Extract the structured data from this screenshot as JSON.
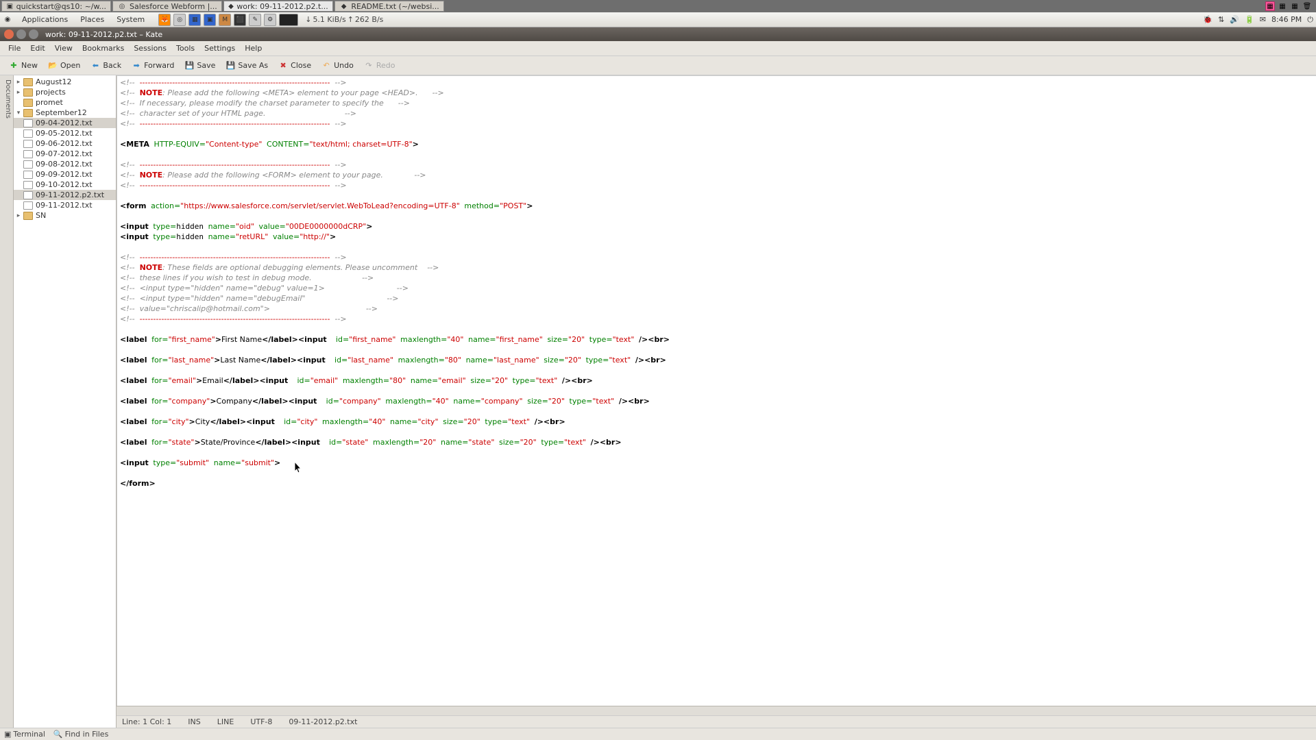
{
  "taskbar": {
    "tabs": [
      {
        "label": "quickstart@qs10: ~/w..."
      },
      {
        "label": "Salesforce Webform |..."
      },
      {
        "label": "work: 09-11-2012.p2.t..."
      },
      {
        "label": "README.txt (~/websi..."
      }
    ]
  },
  "gnome": {
    "menus": [
      "Applications",
      "Places",
      "System"
    ],
    "net_down": "5.1 KiB/s",
    "net_up": "262 B/s",
    "time": "8:46 PM"
  },
  "window": {
    "title": "work: 09-11-2012.p2.txt – Kate"
  },
  "menubar": [
    "File",
    "Edit",
    "View",
    "Bookmarks",
    "Sessions",
    "Tools",
    "Settings",
    "Help"
  ],
  "toolbar": {
    "new": "New",
    "open": "Open",
    "back": "Back",
    "forward": "Forward",
    "save": "Save",
    "saveas": "Save As",
    "close": "Close",
    "undo": "Undo",
    "redo": "Redo"
  },
  "sidebar": {
    "tab": "Documents",
    "folders": {
      "aug": "August12",
      "projects": "projects",
      "promet": "promet",
      "sept": "September12",
      "sn": "SN"
    },
    "files": [
      "09-04-2012.txt",
      "09-05-2012.txt",
      "09-06-2012.txt",
      "09-07-2012.txt",
      "09-08-2012.txt",
      "09-09-2012.txt",
      "09-10-2012.txt",
      "09-11-2012.p2.txt",
      "09-11-2012.txt"
    ],
    "selected": "09-11-2012.p2.txt"
  },
  "code": {
    "note": "NOTE",
    "c1a": "Please add the following <META> element to your page <HEAD>.",
    "c1b": "If necessary, please modify the charset parameter to specify the",
    "c1c": "character set of your HTML page.",
    "meta_httpequiv": "HTTP-EQUIV=",
    "meta_httpequiv_v": "\"Content-type\"",
    "meta_content": "CONTENT=",
    "meta_content_v": "\"text/html; charset=UTF-8\"",
    "c2": "Please add the following <FORM> element to your page.",
    "form_action": "action=",
    "form_action_v": "\"https://www.salesforce.com/servlet/servlet.WebToLead?encoding=UTF-8\"",
    "form_method": "method=",
    "form_method_v": "\"POST\"",
    "hid1_name": "\"oid\"",
    "hid1_val": "\"00DE0000000dCRP\"",
    "hid2_name": "\"retURL\"",
    "hid2_val": "\"http://\"",
    "c3a": "These fields are optional debugging elements. Please uncomment",
    "c3b": "these lines if you wish to test in debug mode.",
    "c3c": "<input type=\"hidden\" name=\"debug\" value=1>",
    "c3d": "<input type=\"hidden\" name=\"debugEmail\"",
    "c3e": "value=\"chriscalip@hotmail.com\">",
    "lbl_first": "First Name",
    "lbl_last": "Last Name",
    "lbl_email": "Email",
    "lbl_company": "Company",
    "lbl_city": "City",
    "lbl_state": "State/Province",
    "first_name": "\"first_name\"",
    "last_name": "\"last_name\"",
    "email": "\"email\"",
    "company": "\"company\"",
    "city": "\"city\"",
    "state": "\"state\"",
    "ml40": "\"40\"",
    "ml80": "\"80\"",
    "sz20": "\"20\"",
    "txt": "\"text\"",
    "submit": "\"submit\""
  },
  "status": {
    "line": "Line: 1 Col: 1",
    "ins": "INS",
    "mode": "LINE",
    "enc": "UTF-8",
    "file": "09-11-2012.p2.txt"
  },
  "bottom": {
    "terminal": "Terminal",
    "find": "Find in Files"
  }
}
